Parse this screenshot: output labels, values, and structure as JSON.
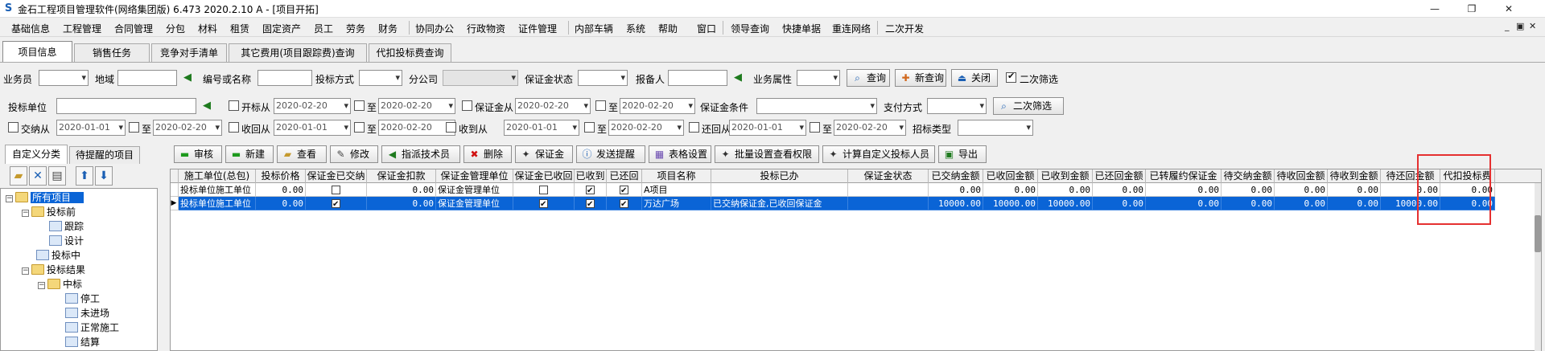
{
  "window": {
    "title": "金石工程项目管理软件(网络集团版) 6.473  2020.2.10 A - [项目开拓]",
    "minimize": "—",
    "maximize": "❐",
    "close": "✕"
  },
  "menu": {
    "items": [
      "基础信息",
      "工程管理",
      "合同管理",
      "分包",
      "材料",
      "租赁",
      "固定资产",
      "员工",
      "劳务",
      "财务",
      "协同办公",
      "行政物资",
      "证件管理",
      "内部车辆",
      "系统",
      "帮助",
      "窗口",
      "领导查询",
      "快捷单据",
      "重连网络",
      "二次开发"
    ],
    "right": [
      "_",
      "▣",
      "✕"
    ]
  },
  "tabs": [
    "项目信息",
    "销售任务",
    "竞争对手清单",
    "其它费用(项目跟踪费)查询",
    "代扣投标费查询"
  ],
  "filters": {
    "row1": {
      "salesman_label": "业务员",
      "region_label": "地域",
      "code_label": "编号或名称",
      "bid_method_label": "投标方式",
      "branch_label": "分公司",
      "deposit_status_label": "保证金状态",
      "reporter_label": "报备人",
      "biz_attr_label": "业务属性",
      "query_btn": "查询",
      "new_query_btn": "新查询",
      "close_btn": "关闭",
      "secondary_label": "二次筛选"
    },
    "row2": {
      "bid_unit_label": "投标单位",
      "open_from_label": "开标从",
      "to1": "至",
      "dep_mgr_from_label": "保证金从",
      "to2": "至",
      "dep_cond_label": "保证金条件",
      "pay_method_label": "支付方式",
      "secondary_btn": "二次筛选",
      "date1": "2020-02-20",
      "date2": "2020-02-20",
      "date3": "2020-02-20",
      "date4": "2020-02-20"
    },
    "row3": {
      "pay_from_label": "交纳从",
      "to1": "至",
      "recv_from_label": "收回从",
      "to2": "至",
      "got_from_label": "收到从",
      "to3": "至",
      "ret_from_label": "还回从",
      "to4": "至",
      "bid_type_label": "招标类型",
      "d1": "2020-01-01",
      "d2": "2020-02-20",
      "d3": "2020-01-01",
      "d4": "2020-02-20",
      "d5": "2020-01-01",
      "d6": "2020-02-20",
      "d7": "2020-01-01",
      "d8": "2020-02-20"
    }
  },
  "left": {
    "tabs": [
      "自定义分类",
      "待提醒的项目"
    ],
    "tree": [
      {
        "label": "所有项目",
        "type": "fold",
        "ex": "-",
        "selected": true
      },
      {
        "label": "投标前",
        "type": "fold",
        "ex": "-"
      },
      {
        "label": "跟踪",
        "type": "doc"
      },
      {
        "label": "设计",
        "type": "doc"
      },
      {
        "label": "投标中",
        "type": "doc"
      },
      {
        "label": "投标结果",
        "type": "fold",
        "ex": "-"
      },
      {
        "label": "中标",
        "type": "fold",
        "ex": "-"
      },
      {
        "label": "停工",
        "type": "doc"
      },
      {
        "label": "未进场",
        "type": "doc"
      },
      {
        "label": "正常施工",
        "type": "doc"
      },
      {
        "label": "结算",
        "type": "doc"
      }
    ]
  },
  "toolbar": [
    "审核",
    "新建",
    "查看",
    "修改",
    "指派技术员",
    "删除",
    "保证金",
    "发送提醒",
    "表格设置",
    "批量设置查看权限",
    "计算自定义投标人员",
    "导出"
  ],
  "grid": {
    "columns": [
      "施工单位(总包)",
      "投标价格",
      "保证金已交纳",
      "保证金扣款",
      "保证金管理单位",
      "保证金已收回",
      "已收到",
      "已还回",
      "项目名称",
      "投标已办",
      "保证金状态",
      "已交纳金额",
      "已收回金额",
      "已收到金额",
      "已还回金额",
      "已转履约保证金",
      "待交纳金额",
      "待收回金额",
      "待收到金额",
      "待还回金额",
      "代扣投标费"
    ],
    "rows": [
      {
        "unit": "投标单位施工单位",
        "price": "0.00",
        "paid": false,
        "deduct": "0.00",
        "mgr": "保证金管理单位",
        "recovered": false,
        "got": true,
        "returned": true,
        "name": "A项目",
        "done": "",
        "status": "",
        "amt": [
          "0.00",
          "0.00",
          "0.00",
          "0.00",
          "0.00",
          "0.00",
          "0.00",
          "0.00",
          "0.00",
          "0.00"
        ]
      },
      {
        "unit": "投标单位施工单位",
        "price": "0.00",
        "paid": true,
        "deduct": "0.00",
        "mgr": "保证金管理单位",
        "recovered": true,
        "got": true,
        "returned": true,
        "name": "万达广场",
        "done": "已交纳保证金,已收回保证金",
        "status": "",
        "amt": [
          "10000.00",
          "10000.00",
          "10000.00",
          "0.00",
          "0.00",
          "0.00",
          "0.00",
          "0.00",
          "10000.00",
          "0.00"
        ]
      }
    ]
  }
}
